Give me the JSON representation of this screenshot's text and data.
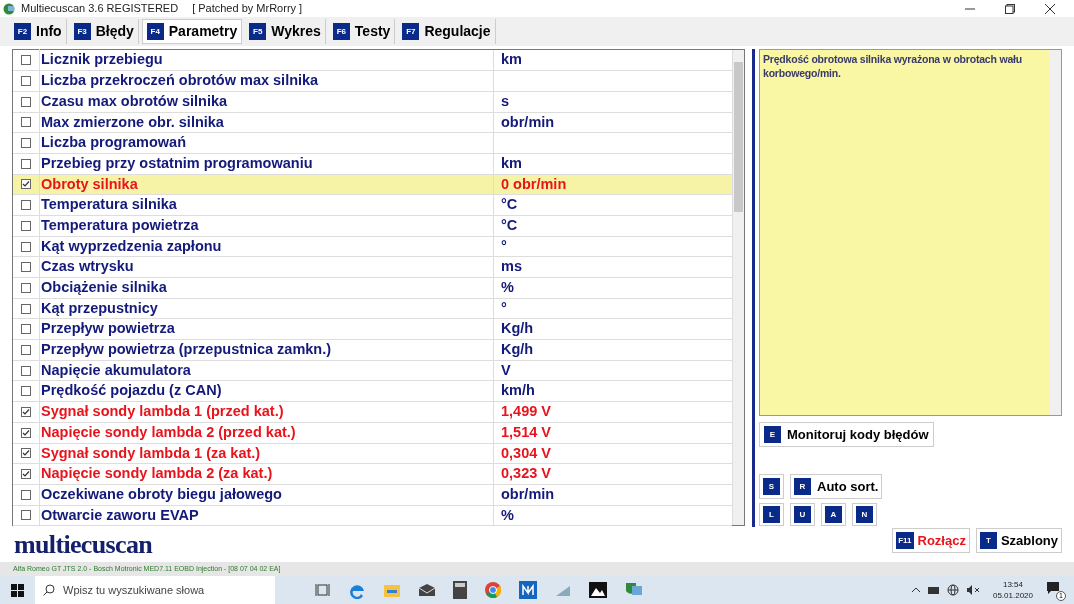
{
  "window": {
    "title": "Multiecuscan 3.6 REGISTERED",
    "subtitle": "[ Patched by MrRorry ]"
  },
  "tabs": [
    {
      "key": "F2",
      "label": "Info",
      "selected": false
    },
    {
      "key": "F3",
      "label": "Błędy",
      "selected": false
    },
    {
      "key": "F4",
      "label": "Parametry",
      "selected": true
    },
    {
      "key": "F5",
      "label": "Wykres",
      "selected": false
    },
    {
      "key": "F6",
      "label": "Testy",
      "selected": false
    },
    {
      "key": "F7",
      "label": "Regulacje",
      "selected": false
    }
  ],
  "parameters": [
    {
      "name": "Licznik przebiegu",
      "value": "km",
      "checked": false,
      "selected": false
    },
    {
      "name": "Liczba przekroczeń obrotów max silnika",
      "checked": false,
      "selected": false
    },
    {
      "name": "Czasu max obrotów silnika",
      "value": "s",
      "checked": false,
      "selected": false
    },
    {
      "name": "Max zmierzone obr. silnika",
      "value": "obr/min",
      "checked": false,
      "selected": false
    },
    {
      "name": "Liczba programowań",
      "checked": false,
      "selected": false
    },
    {
      "name": "Przebieg przy ostatnim programowaniu",
      "value": "km",
      "checked": false,
      "selected": false
    },
    {
      "name": "Obroty silnika",
      "value": "0 obr/min",
      "checked": true,
      "selected": true
    },
    {
      "name": "Temperatura silnika",
      "value": "°C",
      "checked": false,
      "selected": false
    },
    {
      "name": "Temperatura powietrza",
      "value": "°C",
      "checked": false,
      "selected": false
    },
    {
      "name": "Kąt wyprzedzenia zapłonu",
      "value": "°",
      "checked": false,
      "selected": false
    },
    {
      "name": "Czas wtrysku",
      "value": "ms",
      "checked": false,
      "selected": false
    },
    {
      "name": "Obciążenie silnika",
      "value": "%",
      "checked": false,
      "selected": false
    },
    {
      "name": "Kąt przepustnicy",
      "value": "°",
      "checked": false,
      "selected": false
    },
    {
      "name": "Przepływ powietrza",
      "value": "Kg/h",
      "checked": false,
      "selected": false
    },
    {
      "name": "Przepływ powietrza (przepustnica zamkn.)",
      "value": "Kg/h",
      "checked": false,
      "selected": false
    },
    {
      "name": "Napięcie akumulatora",
      "value": "V",
      "checked": false,
      "selected": false
    },
    {
      "name": "Prędkość pojazdu (z CAN)",
      "value": "km/h",
      "checked": false,
      "selected": false
    },
    {
      "name": "Sygnał sondy lambda 1 (przed kat.)",
      "value": "1,499 V",
      "checked": true,
      "selected": false
    },
    {
      "name": "Napięcie sondy lambda 2 (przed kat.)",
      "value": "1,514 V",
      "checked": true,
      "selected": false
    },
    {
      "name": "Sygnał sondy lambda 1 (za kat.)",
      "value": "0,304 V",
      "checked": true,
      "selected": false
    },
    {
      "name": "Napięcie sondy lambda 2 (za kat.)",
      "value": "0,323 V",
      "checked": true,
      "selected": false
    },
    {
      "name": "Oczekiwane obroty biegu jałowego",
      "value": "obr/min",
      "checked": false,
      "selected": false
    },
    {
      "name": "Otwarcie zaworu EVAP",
      "value": "%",
      "checked": false,
      "selected": false
    }
  ],
  "description": "Prędkość obrotowa silnika wyrażona w obrotach wału korbowego/min.",
  "monitor_button": {
    "key": "E",
    "label": "Monitoruj kody błędów"
  },
  "sort_buttons": [
    {
      "key": "S"
    },
    {
      "key": "R",
      "label": "Auto sort."
    }
  ],
  "small_buttons": [
    {
      "key": "L"
    },
    {
      "key": "U"
    },
    {
      "key": "A"
    },
    {
      "key": "N"
    }
  ],
  "bottom_buttons": [
    {
      "key": "F11",
      "label": "Rozłącz",
      "kind": "danger"
    },
    {
      "key": "T",
      "label": "Szablony",
      "kind": "normal"
    }
  ],
  "logo": "multiecuscan",
  "status_bar": "Alfa Romeo GT JTS 2.0 - Bosch Motronic MED7.11 EOBD Injection - [08 07 04 02 EA]",
  "taskbar": {
    "search_placeholder": "Wpisz tu wyszukiwane słowa",
    "time": "13:54",
    "date": "05.01.2020",
    "notifications": "1"
  }
}
